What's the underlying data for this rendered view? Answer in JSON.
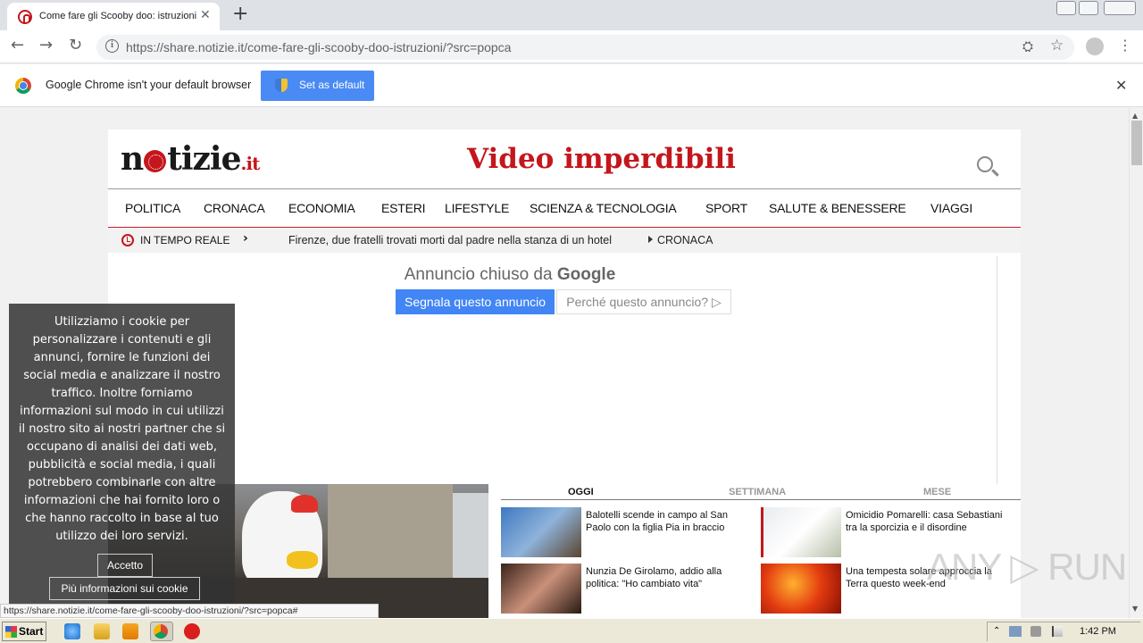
{
  "browser": {
    "tab_title": "Come fare gli Scooby doo: istruzioni |",
    "tab_close": "✕",
    "new_tab": "+",
    "url": "https://share.notizie.it/come-fare-gli-scooby-doo-istruzioni/?src=popca",
    "url_info": "i",
    "nav": {
      "back": "←",
      "forward": "→",
      "reload": "↻",
      "translate": "⛭",
      "star": "☆",
      "menu": "⋮"
    },
    "infobar": {
      "message": "Google Chrome isn't your default browser",
      "button": "Set as default",
      "close": "✕"
    },
    "status_url": "https://share.notizie.it/come-fare-gli-scooby-doo-istruzioni/?src=popca#"
  },
  "site": {
    "logo": {
      "n": "n",
      "rest": "tizie",
      "tld": ".it"
    },
    "headline": "Video imperdibili",
    "nav": [
      "POLITICA",
      "CRONACA",
      "ECONOMIA",
      "ESTERI",
      "LIFESTYLE",
      "SCIENZA & TECNOLOGIA",
      "SPORT",
      "SALUTE & BENESSERE",
      "VIAGGI"
    ],
    "ticker": {
      "label": "IN TEMPO REALE",
      "arrow": "›",
      "text": "Firenze, due fratelli trovati morti dal padre nella stanza di un hotel",
      "category": "CRONACA"
    },
    "ad": {
      "title_prefix": "Annuncio chiuso da ",
      "title_brand": "Google",
      "report": "Segnala questo annuncio",
      "why": "Perché questo annuncio? ▷"
    },
    "trending": {
      "tabs": [
        "OGGI",
        "SETTIMANA",
        "MESE"
      ],
      "items": [
        {
          "title": "Balotelli scende in campo al San Paolo con la figlia Pia in braccio"
        },
        {
          "title": "Omicidio Pomarelli: casa Sebastiani tra la sporcizia e il disordine"
        },
        {
          "title": "Nunzia De Girolamo, addio alla politica: \"Ho cambiato vita\""
        },
        {
          "title": "Una tempesta solare approccia la Terra questo week-end"
        }
      ]
    },
    "cookie": {
      "text": "Utilizziamo i cookie per personalizzare i contenuti e gli annunci, fornire le funzioni dei social media e analizzare il nostro traffico. Inoltre forniamo informazioni sul modo in cui utilizzi il nostro sito ai nostri partner che si occupano di analisi dei dati web, pubblicità e social media, i quali potrebbero combinarle con altre informazioni che hai fornito loro o che hanno raccolto in base al tuo utilizzo dei loro servizi.",
      "accept": "Accetto",
      "more": "Più informazioni sui cookie"
    }
  },
  "taskbar": {
    "start": "Start",
    "time": "1:42 PM"
  },
  "watermark": "ANY ▷ RUN",
  "colors": {
    "brand_red": "#c4161c",
    "chrome_blue": "#4a8af4",
    "google_blue": "#4285f4"
  }
}
